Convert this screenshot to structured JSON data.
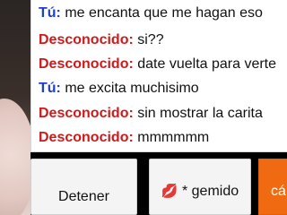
{
  "chat": {
    "messages": [
      {
        "sender": "Tú:",
        "text": "me encanta que me hagan eso",
        "role": "me"
      },
      {
        "sender": "Desconocido:",
        "text": "si??",
        "role": "stranger"
      },
      {
        "sender": "Desconocido:",
        "text": "date vuelta para verte",
        "role": "stranger"
      },
      {
        "sender": "Tú:",
        "text": "me excita muchisimo",
        "role": "me"
      },
      {
        "sender": "Desconocido:",
        "text": "sin mostrar la carita",
        "role": "stranger"
      },
      {
        "sender": "Desconocido:",
        "text": "mmmmmm",
        "role": "stranger"
      }
    ]
  },
  "controls": {
    "stop_label": "Detener",
    "moan_icon": "lips-icon",
    "moan_label": "* gemido",
    "orange_label": "cá"
  },
  "colors": {
    "me_sender": "#1f3ed0",
    "stranger_sender": "#cc1b1b",
    "orange_button": "#f06a12"
  }
}
